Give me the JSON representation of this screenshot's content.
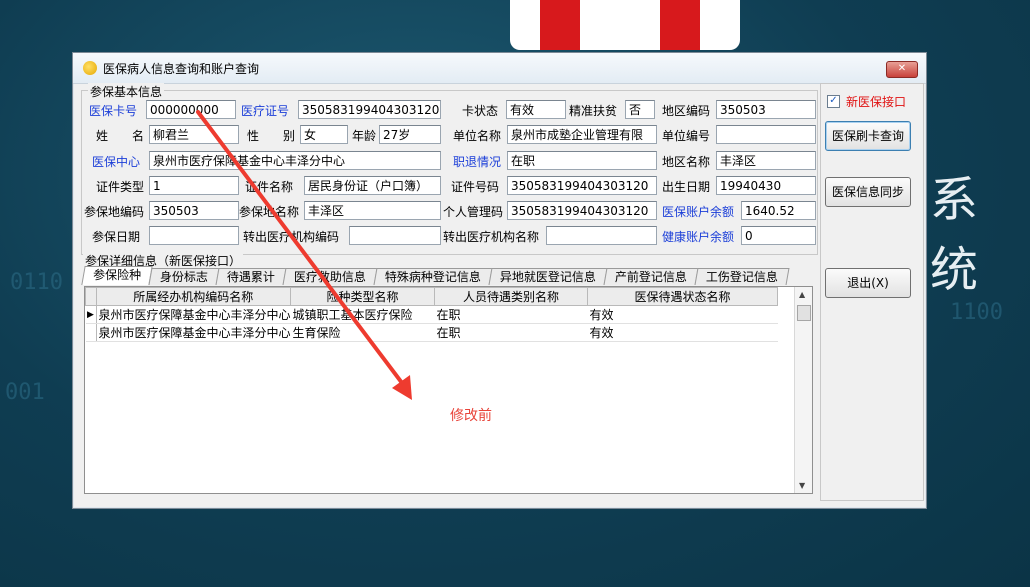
{
  "background": {
    "brand_text": "系 统",
    "bits_1": "0110",
    "bits_2": "1100",
    "bits_3": "001"
  },
  "window": {
    "title": "医保病人信息查询和账户查询",
    "close_glyph": "✕"
  },
  "basic_info": {
    "group_title": "参保基本信息",
    "labels": {
      "card_no": "医保卡号",
      "medical_id": "医疗证号",
      "card_status": "卡状态",
      "poverty": "精准扶贫",
      "area_code": "地区编码",
      "name": "姓　　名",
      "gender": "性　　别",
      "age": "年龄",
      "employer_name": "单位名称",
      "employer_code": "单位编号",
      "center": "医保中心",
      "job_status": "职退情况",
      "area_name": "地区名称",
      "id_type": "证件类型",
      "id_name": "证件名称",
      "id_no": "证件号码",
      "birth": "出生日期",
      "insured_area_code": "参保地编码",
      "insured_area_name": "参保地名称",
      "personal_no": "个人管理码",
      "account_balance": "医保账户余额",
      "insured_date": "参保日期",
      "out_org_code": "转出医疗机构编码",
      "out_org_name": "转出医疗机构名称",
      "health_balance": "健康账户余额"
    },
    "values": {
      "card_no": "000000000",
      "medical_id": "350583199404303120",
      "card_status": "有效",
      "poverty": "否",
      "area_code": "350503",
      "name": "柳君兰",
      "gender": "女",
      "age": "27岁",
      "employer_name": "泉州市成塾企业管理有限",
      "employer_code": "",
      "center": "泉州市医疗保障基金中心丰泽分中心",
      "job_status": "在职",
      "area_name": "丰泽区",
      "id_type": "1",
      "id_name": "居民身份证（户口簿）",
      "id_no": "350583199404303120",
      "birth": "19940430",
      "insured_area_code": "350503",
      "insured_area_name": "丰泽区",
      "personal_no": "350583199404303120",
      "account_balance": "1640.52",
      "insured_date": "",
      "out_org_code": "",
      "out_org_name": "",
      "health_balance": "0"
    }
  },
  "detail": {
    "group_title": "参保详细信息（新医保接口）",
    "tabs": [
      "参保险种",
      "身份标志",
      "待遇累计",
      "医疗救助信息",
      "特殊病种登记信息",
      "异地就医登记信息",
      "产前登记信息",
      "工伤登记信息"
    ],
    "columns": [
      "所属经办机构编码名称",
      "险种类型名称",
      "人员待遇类别名称",
      "医保待遇状态名称"
    ],
    "rows": [
      [
        "泉州市医疗保障基金中心丰泽分中心",
        "城镇职工基本医疗保险",
        "在职",
        "有效"
      ],
      [
        "泉州市医疗保障基金中心丰泽分中心",
        "生育保险",
        "在职",
        "有效"
      ]
    ],
    "row_pointer": "▶"
  },
  "right_panel": {
    "checkbox_label": "新医保接口",
    "checkbox_checked": true,
    "btn_query": "医保刷卡查询",
    "btn_sync": "医保信息同步",
    "btn_exit": "退出(X)"
  },
  "annotation": {
    "text": "修改前",
    "color": "#e8443a"
  }
}
